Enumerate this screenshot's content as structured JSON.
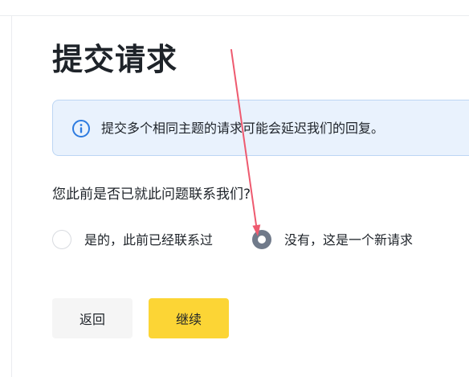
{
  "page": {
    "title": "提交请求"
  },
  "notice": {
    "icon": "info-icon",
    "text": "提交多个相同主题的请求可能会延迟我们的回复。"
  },
  "question": {
    "text": "您此前是否已就此问题联系我们?",
    "options": [
      {
        "label": "是的，此前已经联系过",
        "selected": false
      },
      {
        "label": "没有，这是一个新请求",
        "selected": true
      }
    ]
  },
  "buttons": {
    "back_label": "返回",
    "continue_label": "继续"
  },
  "colors": {
    "accent_yellow": "#fcd535",
    "notice_background": "#e9f2fd",
    "info_icon": "#2d7be0",
    "radio_checked": "#707a8a",
    "annotation_arrow": "#ee5a6f"
  }
}
